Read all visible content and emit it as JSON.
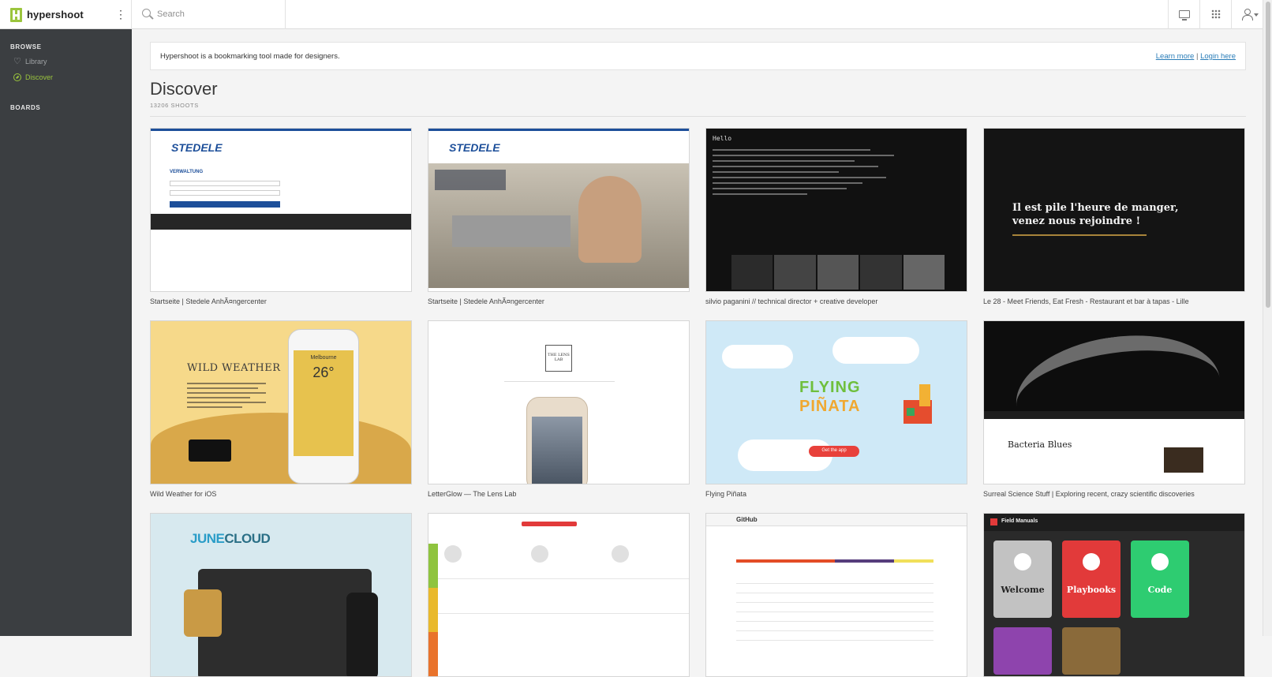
{
  "app": {
    "name": "hypershoot",
    "menu_icon": "kebab-icon",
    "search": {
      "placeholder": "Search",
      "value": ""
    },
    "toolbar_icons": [
      "monitor-icon",
      "grid-icon",
      "user-icon"
    ]
  },
  "sidebar": {
    "browse_heading": "BROWSE",
    "items": [
      {
        "label": "Library",
        "icon": "heart-icon",
        "active": false
      },
      {
        "label": "Discover",
        "icon": "compass-icon",
        "active": true
      }
    ],
    "boards_heading": "BOARDS"
  },
  "banner": {
    "text": "Hypershoot is a bookmarking tool made for designers.",
    "learn_more": "Learn more",
    "separator": "|",
    "login": "Login here"
  },
  "page": {
    "title": "Discover",
    "count": "13206 SHOOTS"
  },
  "shoots": [
    {
      "caption": "Startseite | Stedele AnhÃ¤ngercenter"
    },
    {
      "caption": "Startseite | Stedele AnhÃ¤ngercenter"
    },
    {
      "caption": "silvio paganini // technical director + creative developer"
    },
    {
      "caption": "Le 28 - Meet Friends, Eat Fresh - Restaurant et bar à tapas - Lille"
    },
    {
      "caption": "Wild Weather for iOS"
    },
    {
      "caption": "LetterGlow — The Lens Lab"
    },
    {
      "caption": "Flying Piñata"
    },
    {
      "caption": "Surreal Science Stuff | Exploring recent, crazy scientific discoveries"
    },
    {
      "caption": ""
    },
    {
      "caption": ""
    },
    {
      "caption": ""
    },
    {
      "caption": ""
    }
  ],
  "thumb_text": {
    "stedele_logo": "STEDELE",
    "verwaltung": "VERWALTUNG",
    "hello": "Hello",
    "le28_line1": "Il est pile l'heure de manger,",
    "le28_line2": "venez nous rejoindre !",
    "wild_weather": "WILD WEATHER",
    "melbourne": "Melbourne",
    "temp": "26°",
    "lens": "THE LENS LAB",
    "flying": "FLYING",
    "pinata": "PIÑATA",
    "get_app": "Get the app",
    "bacteria": "Bacteria Blues",
    "june": "JUNE",
    "cloud": "CLOUD",
    "github": "GitHub",
    "fm_welcome": "Welcome",
    "fm_playbooks": "Playbooks",
    "fm_code": "Code",
    "fm_brand": "Field Manuals"
  }
}
